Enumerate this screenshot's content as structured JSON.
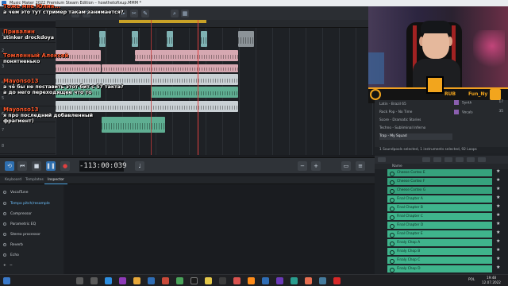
{
  "window": {
    "title": "Music Maker 2022 Premium Steam Edition – howthetofixup.MMM *"
  },
  "chat": [
    {
      "user": "Тоже мне Юлия...",
      "text": "а чем это тут стример такам занимается?"
    },
    {
      "user": "Привалин",
      "text": "stinker drockdoya"
    },
    {
      "user": "Томленный Алексей",
      "text": "понятненько"
    },
    {
      "user": "Mayonso13",
      "text": "а чё бы не поставить этот бит с 57 такта?"
    },
    {
      "user": "",
      "text": "а до него переходящее что то"
    },
    {
      "user": "Mayonso13",
      "text": "я про последний добавленный"
    },
    {
      "user": "",
      "text": "фрагмент)"
    }
  ],
  "transport": {
    "timecode": "-113:00:039"
  },
  "bottom_tabs": [
    "Keyboard",
    "Templates",
    "Inspector"
  ],
  "effects": [
    "VocalTune",
    "Tempo pitch/resample",
    "Compressor",
    "Parametric EQ",
    "Stereo processor",
    "Reverb",
    "Echo"
  ],
  "webcam": {
    "overlay_left": "RUB",
    "overlay_right": "Fun_Ny"
  },
  "sound_pool": {
    "styles": [
      "Latin - Brazil 65",
      "Rock Pop - No Time",
      "Score - Dramatic Stories",
      "Techno - Subliminal Inferno",
      "Trap - My Squad"
    ],
    "selected": "Trap - My Squad",
    "instruments": [
      {
        "name": "Synth",
        "count": "17"
      },
      {
        "name": "Vocals",
        "count": "35"
      }
    ]
  },
  "status_bar": "1 Soundpools selected, 1 instruments selected, 92 Loops",
  "loops": {
    "column_header": "Name",
    "items": [
      "Cheese Cortex E",
      "Cheese Cortex F",
      "Cheese Cortex G",
      "Final Chapter A",
      "Final Chapter B",
      "Final Chapter C",
      "Final Chapter D",
      "Final Chapter E",
      "Finaly Chop A",
      "Finaly Chop B",
      "Finaly Chop C",
      "Finaly Chop D"
    ]
  },
  "taskbar": {
    "lang": "POL",
    "time": "19:48",
    "date": "12.07.2022"
  }
}
